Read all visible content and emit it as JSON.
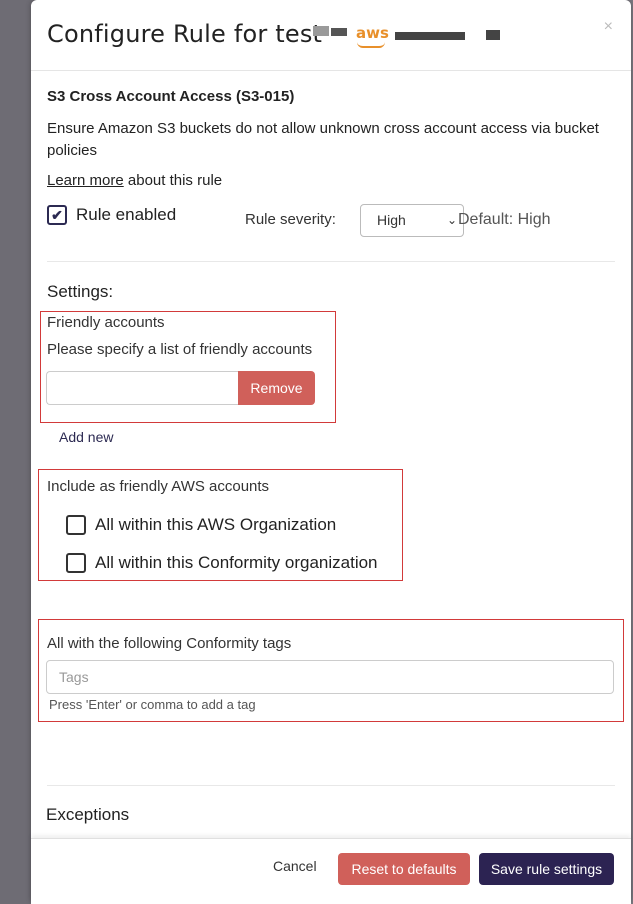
{
  "modal": {
    "title": "Configure Rule for test",
    "aws_logo": "aws",
    "close_glyph": "×"
  },
  "rule": {
    "name": "S3 Cross Account Access (S3-015)",
    "description": "Ensure Amazon S3 buckets do not allow unknown cross account access via bucket policies",
    "learn_more_link": "Learn more",
    "learn_more_suffix": " about this rule",
    "enabled_label": "Rule enabled",
    "enabled": true,
    "severity_label": "Rule severity:",
    "severity_value": "High",
    "default_label": "Default: High"
  },
  "settings": {
    "heading": "Settings:",
    "friendly_accounts": {
      "title": "Friendly accounts",
      "description": "Please specify a list of friendly accounts",
      "input_value": "",
      "remove_label": "Remove",
      "add_new_label": "Add new"
    },
    "include_friendly": {
      "title": "Include as friendly AWS accounts",
      "options": [
        {
          "label": "All within this AWS Organization",
          "checked": false
        },
        {
          "label": "All within this Conformity organization",
          "checked": false
        }
      ]
    },
    "tags": {
      "title": "All with the following Conformity tags",
      "placeholder": "Tags",
      "help": "Press 'Enter' or comma to add a tag"
    },
    "exceptions_heading": "Exceptions"
  },
  "footer": {
    "cancel_label": "Cancel",
    "reset_label": "Reset to defaults",
    "save_label": "Save rule settings"
  },
  "colors": {
    "primary": "#2c2352",
    "danger": "#d0605a",
    "highlight_box": "#d23a3a",
    "aws_orange": "#e8902b"
  }
}
